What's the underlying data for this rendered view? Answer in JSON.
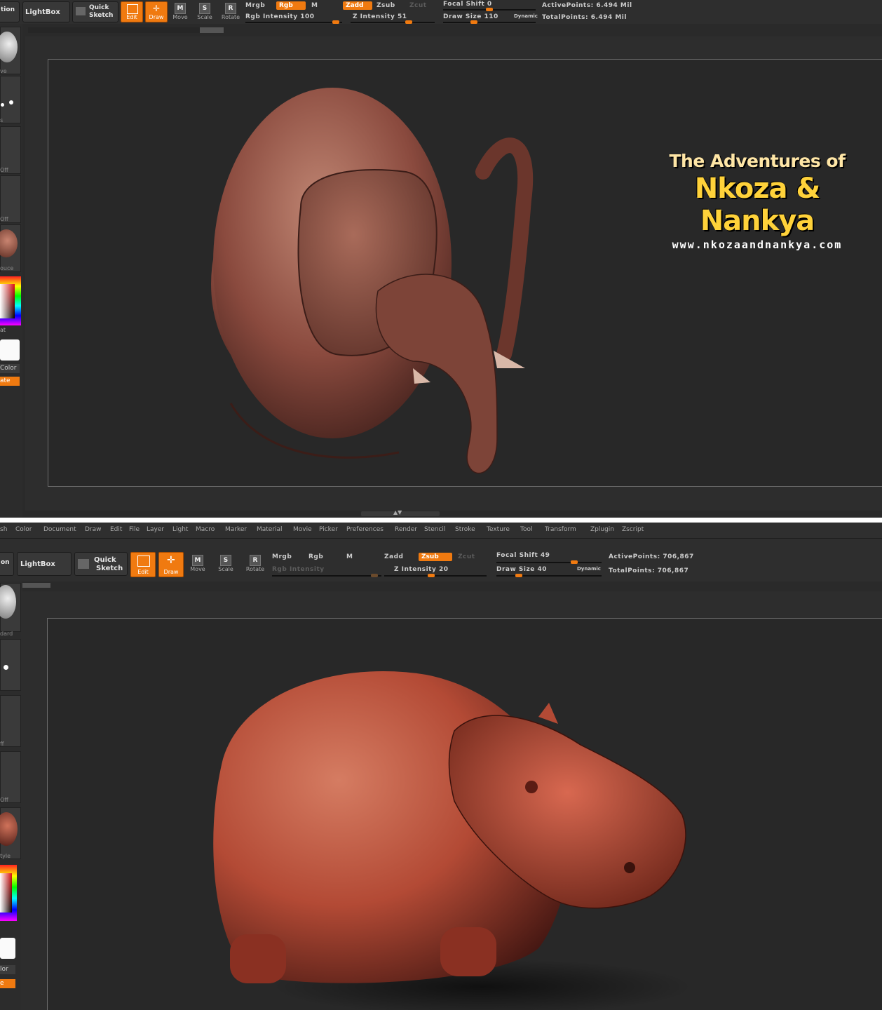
{
  "top_panel": {
    "toolbar": {
      "partial_left_label": "tion",
      "lightbox": "LightBox",
      "quick_sketch": [
        "Quick",
        "Sketch"
      ],
      "edit": "Edit",
      "draw": "Draw",
      "move": "Move",
      "scale": "Scale",
      "rotate": "Rotate",
      "move_icon": "M",
      "scale_icon": "S",
      "rotate_icon": "R",
      "mrgb": "Mrgb",
      "rgb": "Rgb",
      "m": "M",
      "zadd": "Zadd",
      "zsub": "Zsub",
      "zcut": "Zcut",
      "rgb_intensity": "Rgb Intensity 100",
      "z_intensity": "Z Intensity 51",
      "focal_shift": "Focal Shift 0",
      "draw_size": "Draw Size 110",
      "dynamic": "Dynamic",
      "active_points": "ActivePoints: 6.494 Mil",
      "total_points": "TotalPoints: 6.494 Mil"
    },
    "sidebar": {
      "labels": [
        "ve",
        "s",
        "Off",
        "Off",
        "ouce",
        "at",
        "Color",
        "ate"
      ]
    },
    "overlay": {
      "line1": "The Adventures of",
      "line2": "Nkoza & Nankya",
      "line3": "www.nkozaandnankya.com"
    },
    "subject": "elephant-sculpt",
    "colors": {
      "accent": "#f07a10",
      "sculpt": "#8a4a3e"
    }
  },
  "bottom_panel": {
    "menu": [
      "sh",
      "Color",
      "Document",
      "Draw",
      "Edit",
      "File",
      "Layer",
      "Light",
      "Macro",
      "Marker",
      "Material",
      "Movie",
      "Picker",
      "Preferences",
      "Render",
      "Stencil",
      "Stroke",
      "Texture",
      "Tool",
      "Transform",
      "Zplugin",
      "Zscript"
    ],
    "toolbar": {
      "partial_left_label": "on",
      "lightbox": "LightBox",
      "quick_sketch": [
        "Quick",
        "Sketch"
      ],
      "edit": "Edit",
      "draw": "Draw",
      "move": "Move",
      "scale": "Scale",
      "rotate": "Rotate",
      "move_icon": "M",
      "scale_icon": "S",
      "rotate_icon": "R",
      "mrgb": "Mrgb",
      "rgb": "Rgb",
      "m": "M",
      "zadd": "Zadd",
      "zsub": "Zsub",
      "zcut": "Zcut",
      "rgb_intensity": "Rgb Intensity",
      "z_intensity": "Z Intensity 20",
      "focal_shift": "Focal Shift 49",
      "draw_size": "Draw Size 40",
      "dynamic": "Dynamic",
      "active_points": "ActivePoints: 706,867",
      "total_points": "TotalPoints: 706,867"
    },
    "sidebar": {
      "labels": [
        "dard",
        "ff",
        "Off",
        "tyle",
        "lor",
        "e"
      ]
    },
    "subject": "hippo-sculpt",
    "colors": {
      "accent": "#f07a10",
      "sculpt": "#c2503a"
    }
  }
}
